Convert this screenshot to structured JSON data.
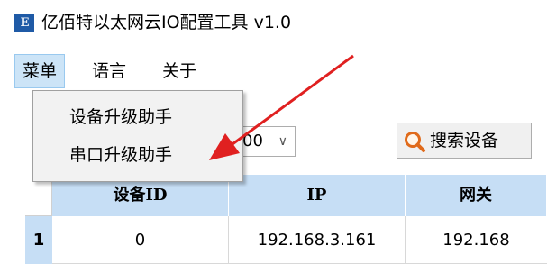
{
  "window": {
    "icon_text": "E",
    "title": "亿佰特以太网云IO配置工具 v1.0"
  },
  "menubar": {
    "items": [
      {
        "label": "菜单"
      },
      {
        "label": "语言"
      },
      {
        "label": "关于"
      }
    ]
  },
  "dropdown": {
    "items": [
      {
        "label": "设备升级助手"
      },
      {
        "label": "串口升级助手"
      }
    ]
  },
  "toolbar": {
    "combo_value": "00",
    "search_label": "搜索设备"
  },
  "table": {
    "columns": [
      "设备ID",
      "IP",
      "网关"
    ],
    "rows": [
      {
        "index": "1",
        "cells": [
          "0",
          "192.168.3.161",
          "192.168"
        ]
      }
    ]
  },
  "colors": {
    "header_bg": "#c6def5",
    "menu_active": "#cce4f7",
    "annotation_arrow": "#e02020"
  },
  "icons": [
    "app-logo-icon",
    "search-icon",
    "chevron-down-icon",
    "annotation-arrow-icon"
  ]
}
